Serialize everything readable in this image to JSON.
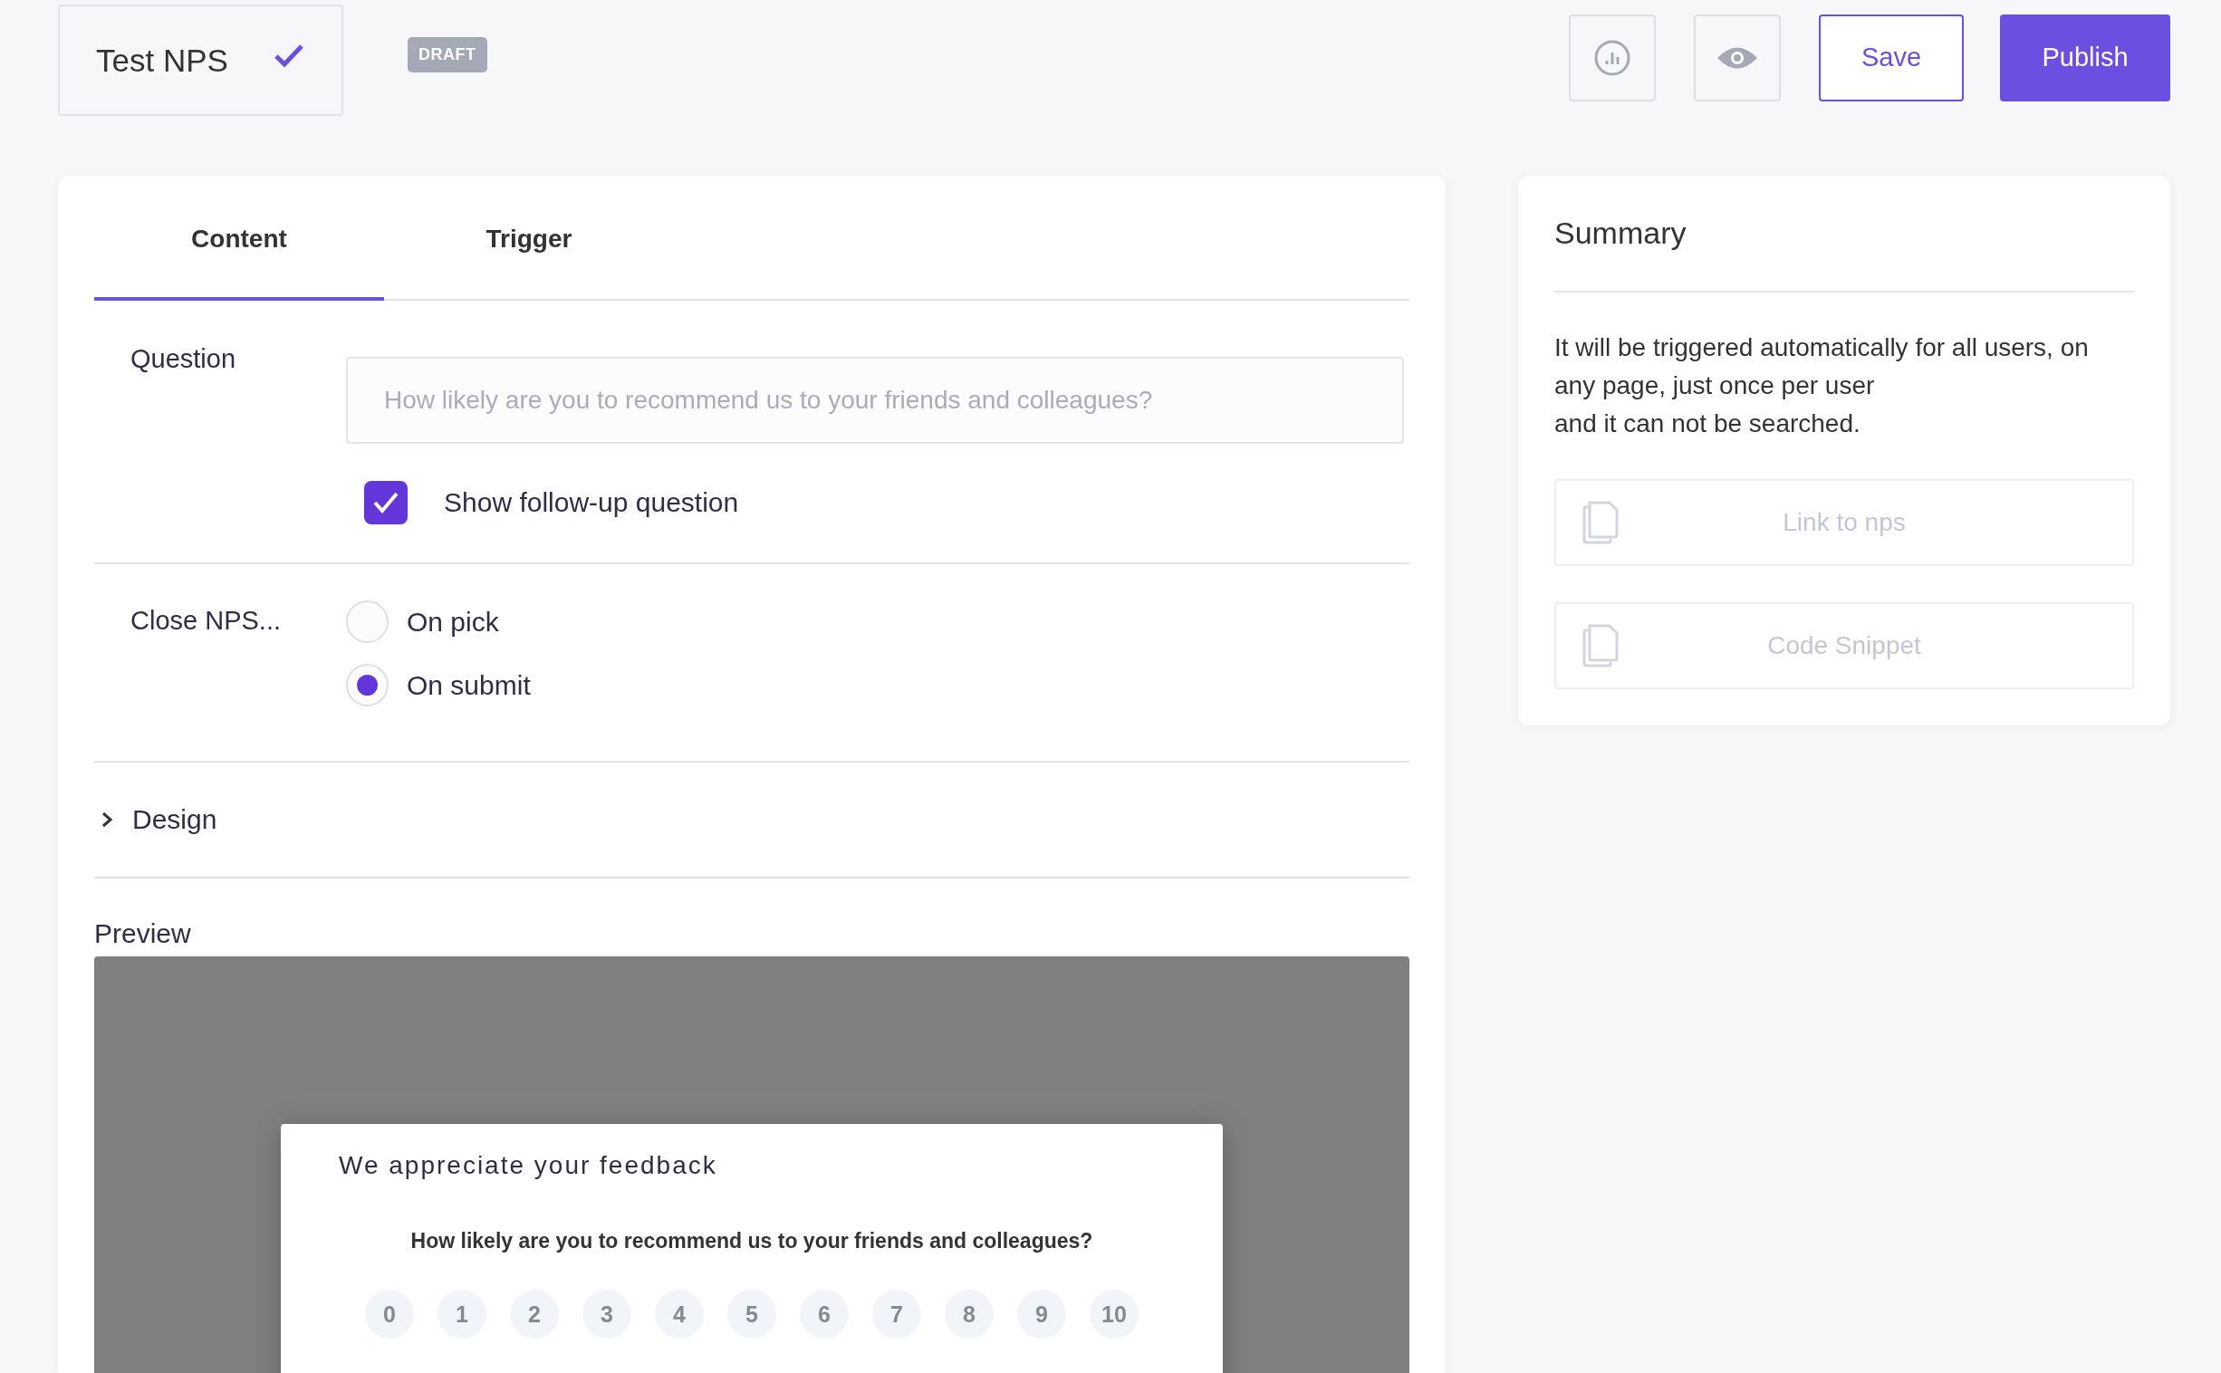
{
  "header": {
    "title": "Test NPS",
    "saved": true,
    "status_badge": "DRAFT",
    "actions": [
      {
        "kind": "stats"
      },
      {
        "kind": "preview"
      },
      {
        "kind": "outline",
        "label": "Save"
      },
      {
        "kind": "primary",
        "label": "Publish"
      }
    ]
  },
  "tabs": [
    {
      "label": "Content",
      "selected": true
    },
    {
      "label": "Trigger",
      "selected": false
    }
  ],
  "question": {
    "label": "Question",
    "placeholder": "How likely are you to recommend us to your friends and colleagues?"
  },
  "follow_up": {
    "label": "Show follow-up question",
    "checked": true
  },
  "close": {
    "label": "Close NPS...",
    "options": [
      {
        "label": "On pick",
        "selected": false
      },
      {
        "label": "On submit",
        "selected": true
      }
    ]
  },
  "design": {
    "label": "Design",
    "expanded": false
  },
  "preview": {
    "label": "Preview",
    "modal": {
      "title": "We appreciate your feedback",
      "question": "How likely are you to recommend us to your friends and colleagues?",
      "scores": [
        "0",
        "1",
        "2",
        "3",
        "4",
        "5",
        "6",
        "7",
        "8",
        "9",
        "10"
      ]
    }
  },
  "summary": {
    "title": "Summary",
    "lines": [
      "It will be triggered automatically for all users, on any page, just once per user",
      "and it can not be searched."
    ],
    "buttons": [
      {
        "label": "Link to nps"
      },
      {
        "label": "Code Snippet"
      }
    ]
  }
}
